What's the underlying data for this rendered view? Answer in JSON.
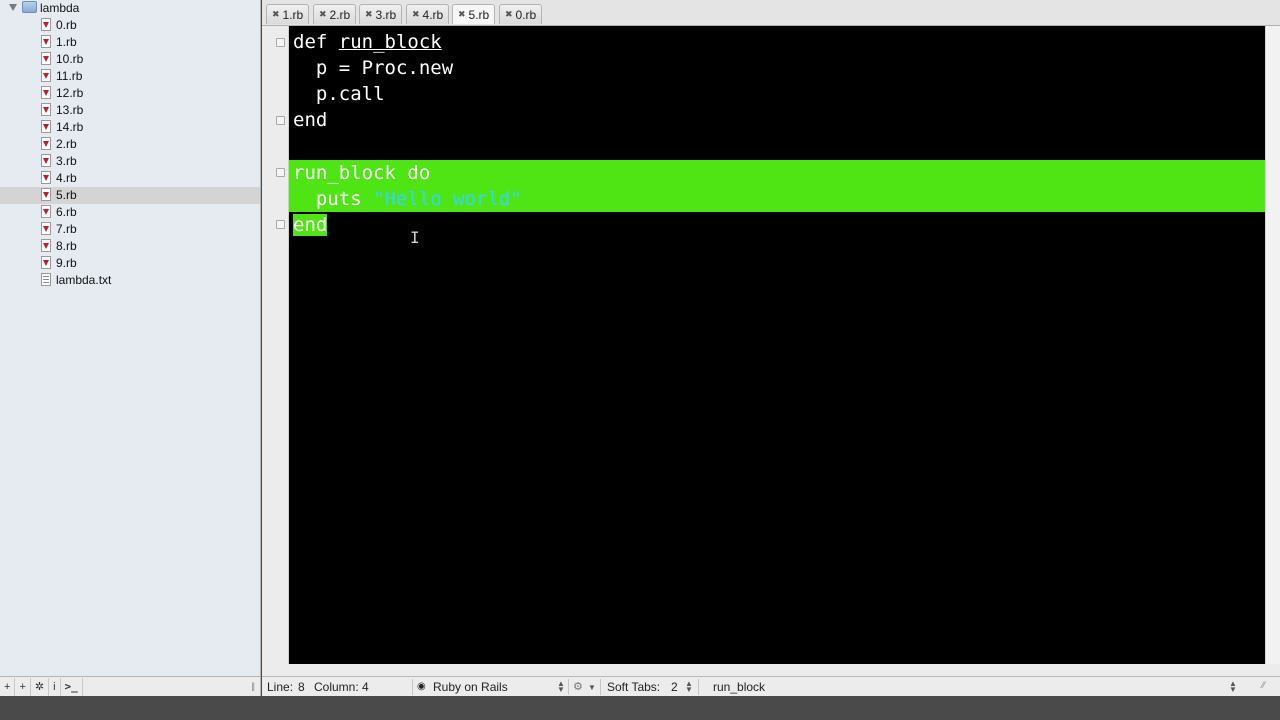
{
  "sidebar": {
    "folder": "lambda",
    "files": [
      {
        "name": "0.rb",
        "type": "ruby"
      },
      {
        "name": "1.rb",
        "type": "ruby"
      },
      {
        "name": "10.rb",
        "type": "ruby"
      },
      {
        "name": "11.rb",
        "type": "ruby"
      },
      {
        "name": "12.rb",
        "type": "ruby"
      },
      {
        "name": "13.rb",
        "type": "ruby"
      },
      {
        "name": "14.rb",
        "type": "ruby"
      },
      {
        "name": "2.rb",
        "type": "ruby"
      },
      {
        "name": "3.rb",
        "type": "ruby"
      },
      {
        "name": "4.rb",
        "type": "ruby"
      },
      {
        "name": "5.rb",
        "type": "ruby",
        "selected": true
      },
      {
        "name": "6.rb",
        "type": "ruby"
      },
      {
        "name": "7.rb",
        "type": "ruby"
      },
      {
        "name": "8.rb",
        "type": "ruby"
      },
      {
        "name": "9.rb",
        "type": "ruby"
      },
      {
        "name": "lambda.txt",
        "type": "text"
      }
    ],
    "toolbar": {
      "new_file": "+",
      "new_folder": "+",
      "actions": "✲",
      "info": "i",
      "terminal": ">_"
    }
  },
  "tabs": [
    {
      "label": "1.rb"
    },
    {
      "label": "2.rb"
    },
    {
      "label": "3.rb"
    },
    {
      "label": "4.rb"
    },
    {
      "label": "5.rb",
      "active": true
    },
    {
      "label": "0.rb"
    }
  ],
  "editor": {
    "lines": {
      "l1_kw": "def",
      "l1_name": "run_block",
      "l2": "  p = Proc.new",
      "l3": "  p.call",
      "l4": "end",
      "l6_call": "run_block",
      "l6_do": "do",
      "l7_puts": "  puts",
      "l7_str": "\"Hello world\"",
      "l8": "end"
    },
    "selection_color": "#4fe414",
    "string_color": "#33d6ff",
    "background": "#000000"
  },
  "status": {
    "line": "Line:",
    "line_value": "8",
    "column": "Column:",
    "column_value": "4",
    "language": "Ruby on Rails",
    "soft_tabs": "Soft Tabs:",
    "soft_tabs_value": "2",
    "symbol": "run_block"
  }
}
